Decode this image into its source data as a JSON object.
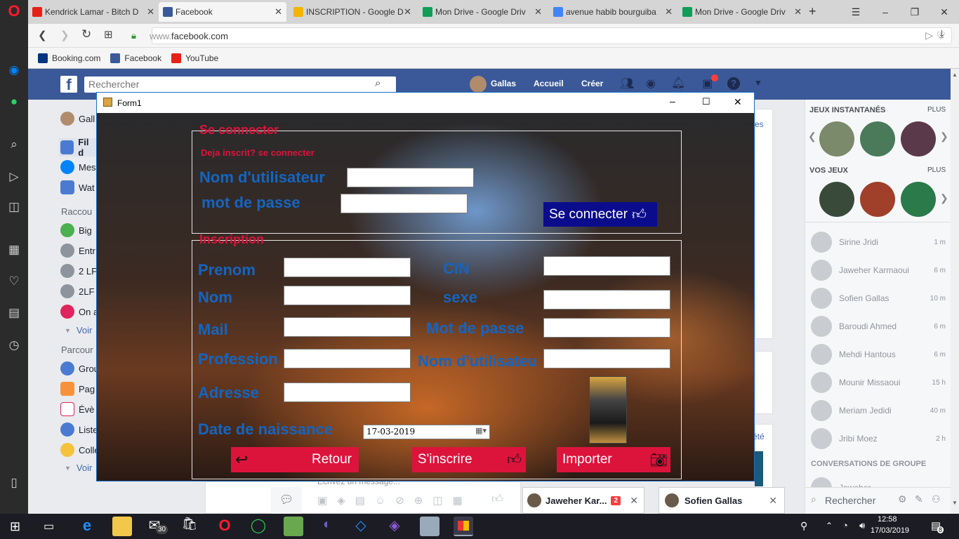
{
  "browser": {
    "tabs": [
      {
        "label": "Kendrick Lamar - Bitch D",
        "color": "#e62117"
      },
      {
        "label": "Facebook",
        "color": "#3b5998"
      },
      {
        "label": "INSCRIPTION - Google D",
        "color": "#f4b400"
      },
      {
        "label": "Mon Drive - Google Driv",
        "color": "#0f9d58"
      },
      {
        "label": "avenue habib bourguiba",
        "color": "#4285f4"
      },
      {
        "label": "Mon Drive - Google Driv",
        "color": "#0f9d58"
      }
    ],
    "url_prefix": "www.",
    "url_domain": "facebook.com",
    "bookmarks": [
      "Booking.com",
      "Facebook",
      "YouTube"
    ]
  },
  "fb": {
    "search_placeholder": "Rechercher",
    "user": "Gallas",
    "nav_home": "Accueil",
    "nav_create": "Créer",
    "left_items": [
      "Gall",
      "Fil d",
      "Mes",
      "Wat"
    ],
    "section1": "Raccou",
    "shortcuts": [
      "Big",
      "Entr",
      "2 LF",
      "2LF",
      "On a"
    ],
    "see_more": "Voir",
    "section2": "Parcour",
    "explore": [
      "Grou",
      "Pag",
      "Évè",
      "Liste",
      "Colle"
    ],
    "see_more2": "Voir",
    "frag_1": "es",
    "frag_2": "été",
    "message_placeholder": "Écrivez un message...",
    "games_title": "JEUX INSTANTANÉS",
    "more": "PLUS",
    "my_games": "VOS JEUX",
    "more2": "PLUS",
    "contacts": [
      {
        "name": "Sirine Jridi",
        "time": "1 m"
      },
      {
        "name": "Jaweher Karmaoui",
        "time": "6 m"
      },
      {
        "name": "Sofien Gallas",
        "time": "10 m"
      },
      {
        "name": "Baroudi Ahmed",
        "time": "6 m"
      },
      {
        "name": "Mehdi Hantous",
        "time": "6 m"
      },
      {
        "name": "Mounir Missaoui",
        "time": "15 h"
      },
      {
        "name": "Meriam Jedidi",
        "time": "40 m"
      },
      {
        "name": "Jribi Moez",
        "time": "2 h"
      }
    ],
    "group_conv": "CONVERSATIONS DE GROUPE",
    "group_member": "Jaweher",
    "chat_search": "Rechercher",
    "chat1": "Jaweher Kar...",
    "chat1_badge": "2",
    "chat2": "Sofien Gallas"
  },
  "form": {
    "title": "Form1",
    "login_group": "Se connecter",
    "login_hint": "Deja inscrit? se connecter",
    "username_label": "Nom d'utilisateur",
    "password_label": "mot de passe",
    "login_button": "Se connecter",
    "signup_group": "Inscription",
    "prenom": "Prenom",
    "nom": "Nom",
    "mail": "Mail",
    "profession": "Profession",
    "adresse": "Adresse",
    "cin": "CIN",
    "sexe": "sexe",
    "mdp": "Mot de passe",
    "nom_utilisateur": "Nom d'utilisateu",
    "dob_label": "Date de naissance",
    "dob_value": "17-03-2019",
    "btn_retour": "Retour",
    "btn_inscrire": "S'inscrire",
    "btn_importer": "Importer"
  },
  "taskbar": {
    "mail_badge": "30",
    "time": "12:58",
    "date": "17/03/2019",
    "notif_count": "8"
  }
}
